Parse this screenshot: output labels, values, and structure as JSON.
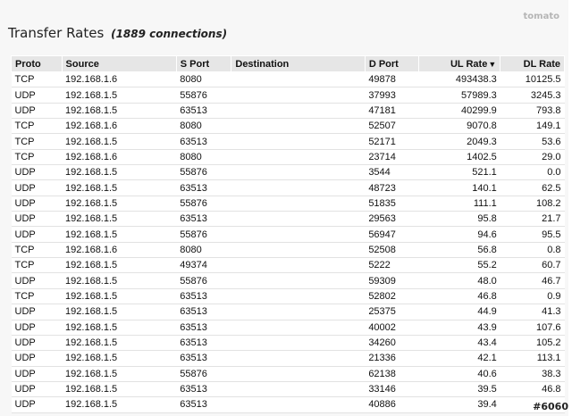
{
  "brand": "tomato",
  "title": "Transfer Rates",
  "subtitle": "(1889 connections)",
  "columns": {
    "proto": "Proto",
    "source": "Source",
    "sport": "S Port",
    "destination": "Destination",
    "dport": "D Port",
    "ul_rate": "UL Rate",
    "dl_rate": "DL Rate"
  },
  "sort": {
    "column": "ul_rate",
    "direction": "descending",
    "indicator": "▼"
  },
  "rows": [
    {
      "proto": "TCP",
      "source": "192.168.1.6",
      "sport": "8080",
      "destination": "",
      "dport": "49878",
      "ul": "493438.3",
      "dl": "10125.5"
    },
    {
      "proto": "UDP",
      "source": "192.168.1.5",
      "sport": "55876",
      "destination": "",
      "dport": "37993",
      "ul": "57989.3",
      "dl": "3245.3"
    },
    {
      "proto": "UDP",
      "source": "192.168.1.5",
      "sport": "63513",
      "destination": "",
      "dport": "47181",
      "ul": "40299.9",
      "dl": "793.8"
    },
    {
      "proto": "TCP",
      "source": "192.168.1.6",
      "sport": "8080",
      "destination": "",
      "dport": "52507",
      "ul": "9070.8",
      "dl": "149.1"
    },
    {
      "proto": "TCP",
      "source": "192.168.1.5",
      "sport": "63513",
      "destination": "",
      "dport": "52171",
      "ul": "2049.3",
      "dl": "53.6"
    },
    {
      "proto": "TCP",
      "source": "192.168.1.6",
      "sport": "8080",
      "destination": "",
      "dport": "23714",
      "ul": "1402.5",
      "dl": "29.0"
    },
    {
      "proto": "UDP",
      "source": "192.168.1.5",
      "sport": "55876",
      "destination": "",
      "dport": "3544",
      "ul": "521.1",
      "dl": "0.0"
    },
    {
      "proto": "UDP",
      "source": "192.168.1.5",
      "sport": "63513",
      "destination": "",
      "dport": "48723",
      "ul": "140.1",
      "dl": "62.5"
    },
    {
      "proto": "UDP",
      "source": "192.168.1.5",
      "sport": "55876",
      "destination": "",
      "dport": "51835",
      "ul": "111.1",
      "dl": "108.2"
    },
    {
      "proto": "UDP",
      "source": "192.168.1.5",
      "sport": "63513",
      "destination": "",
      "dport": "29563",
      "ul": "95.8",
      "dl": "21.7"
    },
    {
      "proto": "UDP",
      "source": "192.168.1.5",
      "sport": "55876",
      "destination": "",
      "dport": "56947",
      "ul": "94.6",
      "dl": "95.5"
    },
    {
      "proto": "TCP",
      "source": "192.168.1.6",
      "sport": "8080",
      "destination": "",
      "dport": "52508",
      "ul": "56.8",
      "dl": "0.8"
    },
    {
      "proto": "TCP",
      "source": "192.168.1.5",
      "sport": "49374",
      "destination": "",
      "dport": "5222",
      "ul": "55.2",
      "dl": "60.7"
    },
    {
      "proto": "UDP",
      "source": "192.168.1.5",
      "sport": "55876",
      "destination": "",
      "dport": "59309",
      "ul": "48.0",
      "dl": "46.7"
    },
    {
      "proto": "TCP",
      "source": "192.168.1.5",
      "sport": "63513",
      "destination": "",
      "dport": "52802",
      "ul": "46.8",
      "dl": "0.9"
    },
    {
      "proto": "UDP",
      "source": "192.168.1.5",
      "sport": "63513",
      "destination": "",
      "dport": "25375",
      "ul": "44.9",
      "dl": "41.3"
    },
    {
      "proto": "UDP",
      "source": "192.168.1.5",
      "sport": "63513",
      "destination": "",
      "dport": "40002",
      "ul": "43.9",
      "dl": "107.6"
    },
    {
      "proto": "UDP",
      "source": "192.168.1.5",
      "sport": "63513",
      "destination": "",
      "dport": "34260",
      "ul": "43.4",
      "dl": "105.2"
    },
    {
      "proto": "UDP",
      "source": "192.168.1.5",
      "sport": "63513",
      "destination": "",
      "dport": "21336",
      "ul": "42.1",
      "dl": "113.1"
    },
    {
      "proto": "UDP",
      "source": "192.168.1.5",
      "sport": "55876",
      "destination": "",
      "dport": "62138",
      "ul": "40.6",
      "dl": "38.3"
    },
    {
      "proto": "UDP",
      "source": "192.168.1.5",
      "sport": "63513",
      "destination": "",
      "dport": "33146",
      "ul": "39.5",
      "dl": "46.8"
    },
    {
      "proto": "UDP",
      "source": "192.168.1.5",
      "sport": "63513",
      "destination": "",
      "dport": "40886",
      "ul": "39.4",
      "dl": ""
    }
  ],
  "watermark": "#6060"
}
